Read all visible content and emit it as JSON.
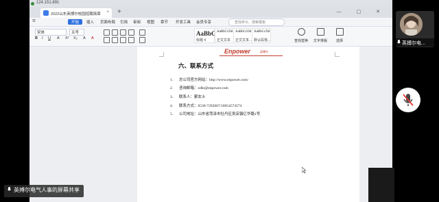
{
  "topbar": {
    "ip": "124.151.891"
  },
  "tab": {
    "title": "2022山东英搏尔校园招聘简章",
    "close": "×",
    "add": "+"
  },
  "window_controls": "— ▢ ✕",
  "menu": {
    "items": [
      "开始",
      "插入",
      "页面布局",
      "引用",
      "审阅",
      "视图",
      "章节",
      "开发工具",
      "会员专享"
    ],
    "active_index": 0,
    "search_placeholder": "查找命令、搜索模板"
  },
  "toolbar": {
    "font_name": "宋体",
    "font_size": "五号",
    "styles": [
      {
        "sample": "AaBbC",
        "name": "标题 4"
      },
      {
        "sample": "AaBbCcDd",
        "name": "正文文本"
      },
      {
        "sample": "AaBbCcDd",
        "name": "正文文本..."
      },
      {
        "sample": "AaBbCcDd",
        "name": "默认段落..."
      }
    ],
    "find_label": "查找替换",
    "text_layout_label": "文字排版",
    "select_label": "选择"
  },
  "document": {
    "logo": "Enpower",
    "logo_cn": "英搏尔",
    "heading": "六、联系方式",
    "items": [
      {
        "num": "1.",
        "text": "总公司官方网站：http://www.enpower.com/"
      },
      {
        "num": "2.",
        "text": "咨询邮箱：zdhr@enpower.com"
      },
      {
        "num": "3.",
        "text": "联系人：鄞女士"
      },
      {
        "num": "4.",
        "text": "联系方式：0530-7292067/18054574574"
      },
      {
        "num": "5.",
        "text": "公司地址：山东省菏泽市牡丹区吴店镇亿华路1号"
      }
    ]
  },
  "overlay": {
    "share_label": "英搏尔电气人事的屏幕共享",
    "participant_name": "英搏尔电..."
  }
}
